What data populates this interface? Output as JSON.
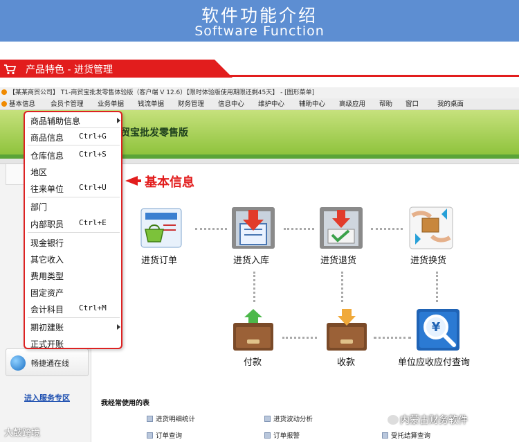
{
  "banner": {
    "title_cn": "软件功能介绍",
    "title_en": "Software Function"
  },
  "section": {
    "title": "产品特色 - 进货管理"
  },
  "window": {
    "title": "【某某商贸公司】 T1-商贸宝批发零售体验版（客户端 V 12.6）【限时体验版使用期限还剩45天】 - [图形菜单]",
    "brand": "贸宝批发零售版",
    "menu": [
      "基本信息",
      "会员卡管理",
      "业务单据",
      "钱流单据",
      "财务管理",
      "信息中心",
      "维护中心",
      "辅助中心",
      "高级应用",
      "帮助",
      "窗口",
      "我的桌面"
    ]
  },
  "dropdown": {
    "items": [
      {
        "label": "商品辅助信息",
        "shortcut": "",
        "submenu": true
      },
      {
        "label": "商品信息",
        "shortcut": "Ctrl+G",
        "submenu": false
      },
      {
        "label": "仓库信息",
        "shortcut": "Ctrl+S",
        "submenu": false
      },
      {
        "label": "地区",
        "shortcut": "",
        "submenu": false
      },
      {
        "label": "往来单位",
        "shortcut": "Ctrl+U",
        "submenu": false
      },
      {
        "label": "部门",
        "shortcut": "",
        "submenu": false
      },
      {
        "label": "内部职员",
        "shortcut": "Ctrl+E",
        "submenu": false
      },
      {
        "label": "现金银行",
        "shortcut": "",
        "submenu": false
      },
      {
        "label": "其它收入",
        "shortcut": "",
        "submenu": false
      },
      {
        "label": "费用类型",
        "shortcut": "",
        "submenu": false
      },
      {
        "label": "固定资产",
        "shortcut": "",
        "submenu": false
      },
      {
        "label": "会计科目",
        "shortcut": "Ctrl+M",
        "submenu": false
      },
      {
        "label": "期初建账",
        "shortcut": "",
        "submenu": true
      },
      {
        "label": "正式开账",
        "shortcut": "",
        "submenu": false
      }
    ]
  },
  "callout": {
    "text": "基本信息"
  },
  "flow": {
    "purchase_order": "进货订单",
    "purchase_in": "进货入库",
    "purchase_return": "进货退货",
    "purchase_exchange": "进货换货",
    "payment": "付款",
    "receipt": "收款",
    "ar_ap_query": "单位应收应付查询"
  },
  "left_panel": {
    "online": "畅捷通在线",
    "service": "进入服务专区"
  },
  "frequent": {
    "title": "我经常使用的表",
    "items": [
      "进货明细统计",
      "进货波动分析",
      "订单查询",
      "订单报警",
      "受托结算查询"
    ]
  },
  "watermarks": {
    "left": "大鼓跨境",
    "right": "内蒙古财务软件"
  },
  "colors": {
    "accent_red": "#e21d1d",
    "banner_blue": "#5d8ed2",
    "brand_green": "#8fc33d"
  }
}
